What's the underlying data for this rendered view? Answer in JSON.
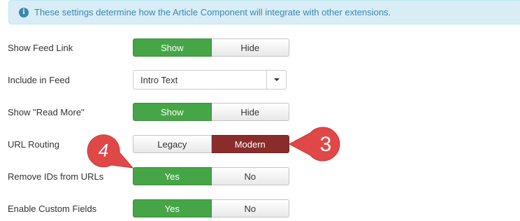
{
  "alert": {
    "icon": "info-icon",
    "text": "These settings determine how the Article Component will integrate with other extensions."
  },
  "settings": {
    "show_feed_link": {
      "label": "Show Feed Link",
      "option1": "Show",
      "option2": "Hide",
      "selected": "Show"
    },
    "include_in_feed": {
      "label": "Include in Feed",
      "value": "Intro Text"
    },
    "show_read_more": {
      "label": "Show \"Read More\"",
      "option1": "Show",
      "option2": "Hide",
      "selected": "Show"
    },
    "url_routing": {
      "label": "URL Routing",
      "option1": "Legacy",
      "option2": "Modern",
      "selected": "Modern"
    },
    "remove_ids": {
      "label": "Remove IDs from URLs",
      "option1": "Yes",
      "option2": "No",
      "selected": "Yes"
    },
    "custom_fields": {
      "label": "Enable Custom Fields",
      "option1": "Yes",
      "option2": "No",
      "selected": "Yes"
    }
  },
  "callouts": {
    "number3": "3",
    "number4": "4"
  },
  "colors": {
    "active_green": "#46a546",
    "active_red": "#8a2c2c",
    "callout_red": "#e04848",
    "alert_bg": "#d9edf7",
    "alert_text": "#3a87ad"
  }
}
